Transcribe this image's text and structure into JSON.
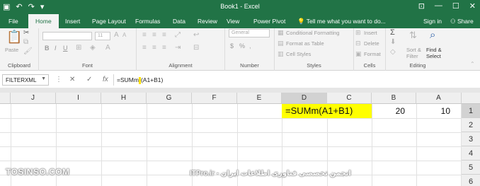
{
  "window": {
    "title": "Book1 - Excel",
    "qat_icons": [
      "save-icon",
      "undo-icon",
      "redo-icon",
      "customize-qat-icon"
    ],
    "controls": [
      "restore-ribbon-icon",
      "minimize-icon",
      "maximize-icon",
      "close-icon"
    ]
  },
  "tabs": [
    {
      "label": "File"
    },
    {
      "label": "Home"
    },
    {
      "label": "Insert"
    },
    {
      "label": "Page Layout"
    },
    {
      "label": "Formulas"
    },
    {
      "label": "Data"
    },
    {
      "label": "Review"
    },
    {
      "label": "View"
    },
    {
      "label": "Power Pivot"
    }
  ],
  "tell_me": "Tell me what you want to do...",
  "sign_in": "Sign in",
  "share": "Share",
  "active_tab": "Home",
  "ribbon": {
    "clipboard": {
      "label": "Clipboard",
      "paste": "Paste"
    },
    "font": {
      "label": "Font",
      "size": "11",
      "bold": "B",
      "italic": "I",
      "underline": "U"
    },
    "alignment": {
      "label": "Alignment"
    },
    "number": {
      "label": "Number",
      "format": "General",
      "currency": "$",
      "percent": "%"
    },
    "styles": {
      "label": "Styles",
      "conditional": "Conditional Formatting",
      "format_table": "Format as Table",
      "cell_styles": "Cell Styles"
    },
    "cells": {
      "label": "Cells",
      "insert": "Insert",
      "delete": "Delete",
      "format": "Format"
    },
    "editing": {
      "label": "Editing",
      "sort": "Sort &",
      "filter": "Filter",
      "find": "Find &",
      "select": "Select"
    }
  },
  "formula_bar": {
    "name_box": "FILTERXML",
    "cancel": "✕",
    "enter": "✓",
    "fx": "fx",
    "formula_before": "=SUMm",
    "formula_after": "(A1+B1)"
  },
  "columns": [
    "J",
    "I",
    "H",
    "G",
    "F",
    "E",
    "D",
    "C",
    "B",
    "A"
  ],
  "selected_column": "D",
  "rows": [
    "1",
    "2",
    "3",
    "4",
    "5",
    "6"
  ],
  "selected_row": "1",
  "cells": {
    "D1": "=SUMm(A1+B1)",
    "B1": "20",
    "A1": "10"
  },
  "colors": {
    "excel_green": "#217346",
    "highlight": "#ffff00",
    "header_selected": "#d2d2d2"
  },
  "watermark": {
    "left": "TOSINSO.COM",
    "right": "ITPro.ir - انجمن تخصصی فناوری اطلاعات ایران"
  }
}
